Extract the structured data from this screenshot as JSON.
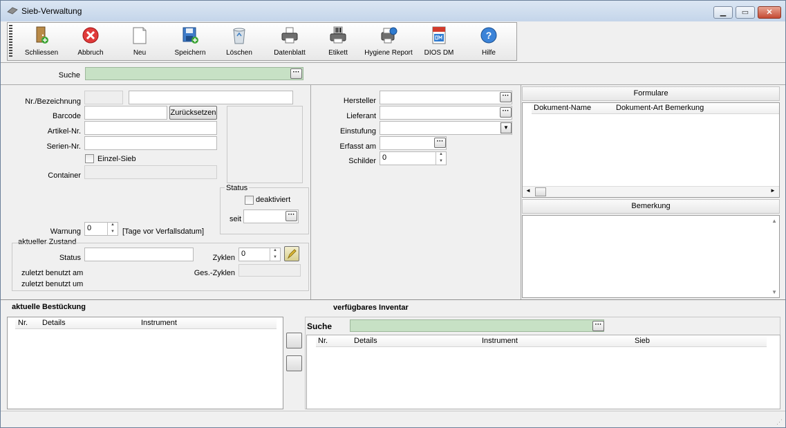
{
  "window": {
    "title": "Sieb-Verwaltung"
  },
  "toolbar": {
    "buttons": [
      {
        "id": "schliessen",
        "label": "Schliessen",
        "icon": "exit-door-icon"
      },
      {
        "id": "abbruch",
        "label": "Abbruch",
        "icon": "cancel-icon"
      },
      {
        "id": "neu",
        "label": "Neu",
        "icon": "new-document-icon"
      },
      {
        "id": "speichern",
        "label": "Speichern",
        "icon": "save-icon"
      },
      {
        "id": "loeschen",
        "label": "Löschen",
        "icon": "recycle-bin-icon"
      },
      {
        "id": "datenblatt",
        "label": "Datenblatt",
        "icon": "printer-icon"
      },
      {
        "id": "etikett",
        "label": "Etikett",
        "icon": "barcode-printer-icon"
      },
      {
        "id": "hygiene",
        "label": "Hygiene Report",
        "icon": "hygiene-report-icon"
      },
      {
        "id": "dios",
        "label": "DIOS DM",
        "icon": "pdf-qm-icon"
      },
      {
        "id": "hilfe",
        "label": "Hilfe",
        "icon": "help-icon"
      }
    ]
  },
  "search": {
    "label": "Suche",
    "value": ""
  },
  "form": {
    "nr_label": "Nr./Bezeichnung",
    "barcode_label": "Barcode",
    "reset_button": "Zurücksetzen",
    "artikel_label": "Artikel-Nr.",
    "serien_label": "Serien-Nr.",
    "einzel_label": "Einzel-Sieb",
    "container_label": "Container",
    "status_group": "Status",
    "deaktiviert_label": "deaktiviert",
    "seit_label": "seit",
    "warnung_label": "Warnung",
    "warnung_value": "0",
    "warnung_hint": "[Tage vor Verfallsdatum]",
    "zustand_label": "aktueller Zustand",
    "status_label": "Status",
    "zyklen_label": "Zyklen",
    "zyklen_value": "0",
    "ges_zyklen_label": "Ges.-Zyklen",
    "zuletzt_am_label": "zuletzt benutzt am",
    "zuletzt_um_label": "zuletzt benutzt um"
  },
  "mid": {
    "hersteller_label": "Hersteller",
    "lieferant_label": "Lieferant",
    "einstufung_label": "Einstufung",
    "erfasst_label": "Erfasst am",
    "schilder_label": "Schilder",
    "schilder_value": "0"
  },
  "formulare": {
    "title": "Formulare",
    "columns": [
      "Dokument-Name",
      "Dokument-Art",
      "Bemerkung"
    ]
  },
  "bemerkung": {
    "title": "Bemerkung"
  },
  "bestueckung": {
    "title": "aktuelle Bestückung",
    "columns": [
      "Nr.",
      "Details",
      "Instrument"
    ]
  },
  "inventar": {
    "title": "verfügbares Inventar",
    "search_label": "Suche",
    "columns": [
      "Nr.",
      "Details",
      "Instrument",
      "Sieb"
    ]
  }
}
